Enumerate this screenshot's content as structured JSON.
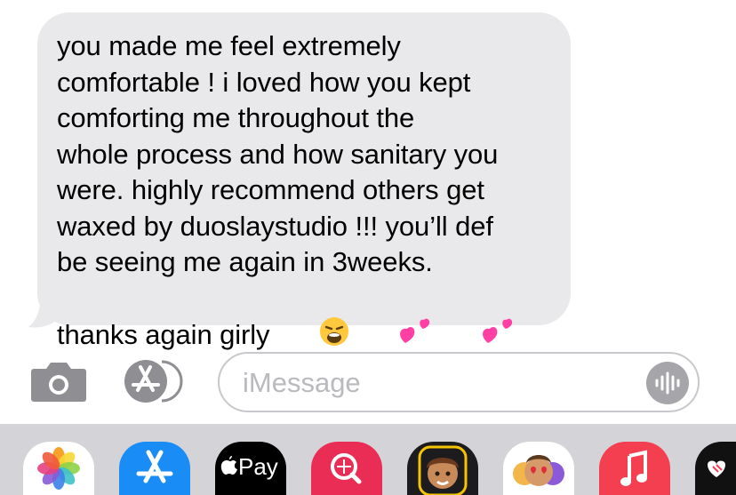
{
  "message": {
    "text": "you made me feel extremely\ncomfortable ! i loved how you kept\ncomforting me throughout the\nwhole process and how sanitary you\nwere. highly recommend others get\nwaxed by duoslaystudio !!! you’ll def\nbe seeing me again in 3weeks.\nthanks again girly",
    "emojis": [
      "😩",
      "💞",
      "💞"
    ]
  },
  "input": {
    "placeholder": "iMessage",
    "value": ""
  },
  "toolbar": {
    "camera_icon": "camera-icon",
    "apps_icon": "app-store-icon",
    "audio_icon": "audio-waveform-icon"
  },
  "app_drawer": [
    {
      "name": "photos-app",
      "color": "#ffffff"
    },
    {
      "name": "app-store-app",
      "color": "#1a8cf5"
    },
    {
      "name": "apple-pay-app",
      "label": "Pay",
      "color": "#000000"
    },
    {
      "name": "search-images-app",
      "color": "#ea2d55"
    },
    {
      "name": "memoji-app",
      "color": "#1c1c1e"
    },
    {
      "name": "memoji-stickers-app",
      "color": "#ffffff"
    },
    {
      "name": "music-app",
      "color": "#f43f51"
    },
    {
      "name": "digital-touch-app",
      "color": "#111111"
    }
  ],
  "colors": {
    "bubble": "#e9e9eb",
    "drawer": "#d3d3d8",
    "icon_gray": "#8e8e93",
    "placeholder": "#b9b9be"
  }
}
